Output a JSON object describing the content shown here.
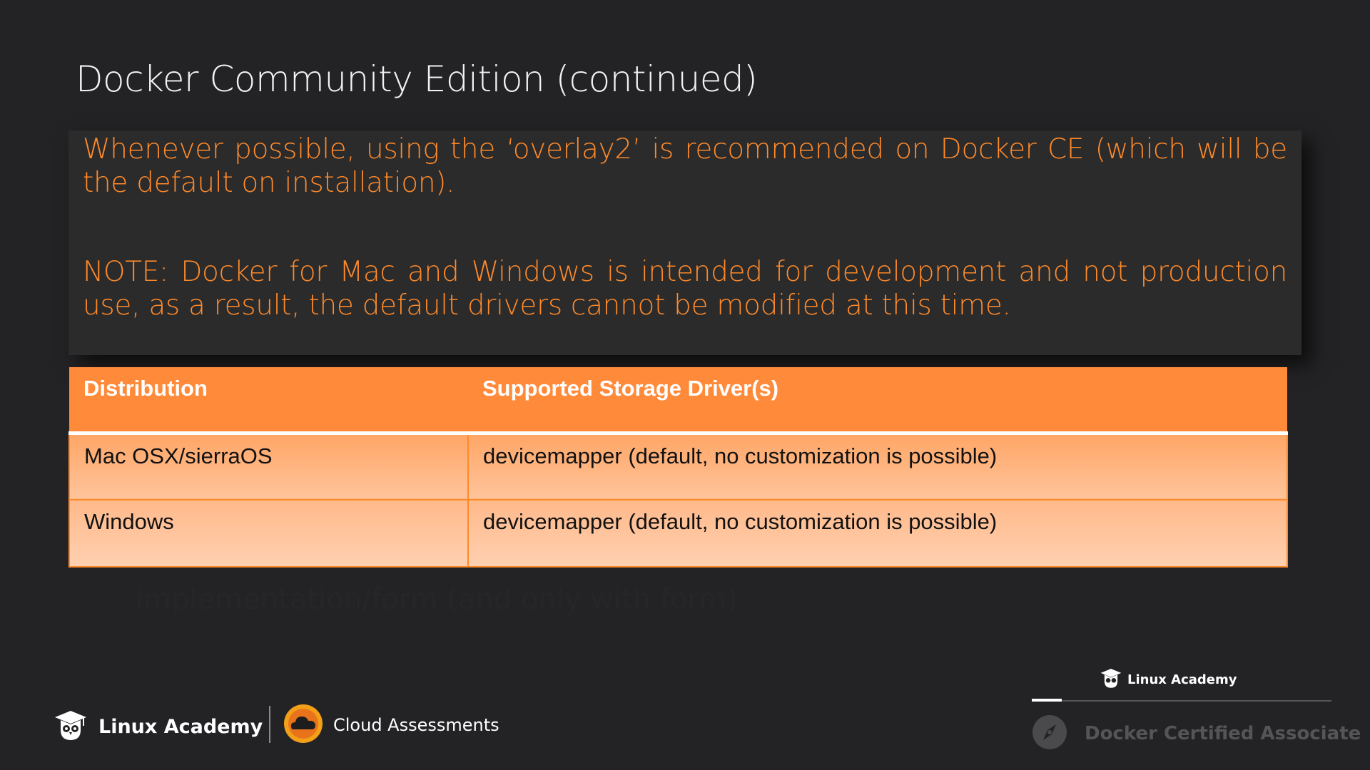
{
  "slide": {
    "title": "Docker Community Edition (continued)",
    "note_paragraph_1": "Whenever possible, using  the ‘overlay2’ is recommended on Docker CE (which will be the default on installation).",
    "note_paragraph_2": "NOTE: Docker for Mac and Windows is intended for development and not production use, as a result, the default drivers cannot be modified at this time.",
    "background_text": "implementation/form (and only with form)"
  },
  "table": {
    "headers": [
      "Distribution",
      "Supported Storage Driver(s)"
    ],
    "rows": [
      [
        "Mac OSX/sierraOS",
        "devicemapper (default, no customization is possible)"
      ],
      [
        "Windows",
        "devicemapper (default, no customization is possible)"
      ]
    ]
  },
  "footer": {
    "brand": "Linux Academy",
    "cloud_label": "Cloud Assessments",
    "icons": [
      "owl-graduation-cap-icon",
      "cloud-assessments-icon"
    ]
  },
  "course_widget": {
    "brand": "Linux Academy",
    "course": "Docker Certified Associate",
    "progress_fraction": 0.1,
    "icons": [
      "owl-graduation-cap-icon",
      "compass-icon"
    ]
  },
  "colors": {
    "background": "#232325",
    "accent_orange": "#ff8a2a",
    "header_orange": "#ff8a3a",
    "row_light": "#ffc49b"
  }
}
